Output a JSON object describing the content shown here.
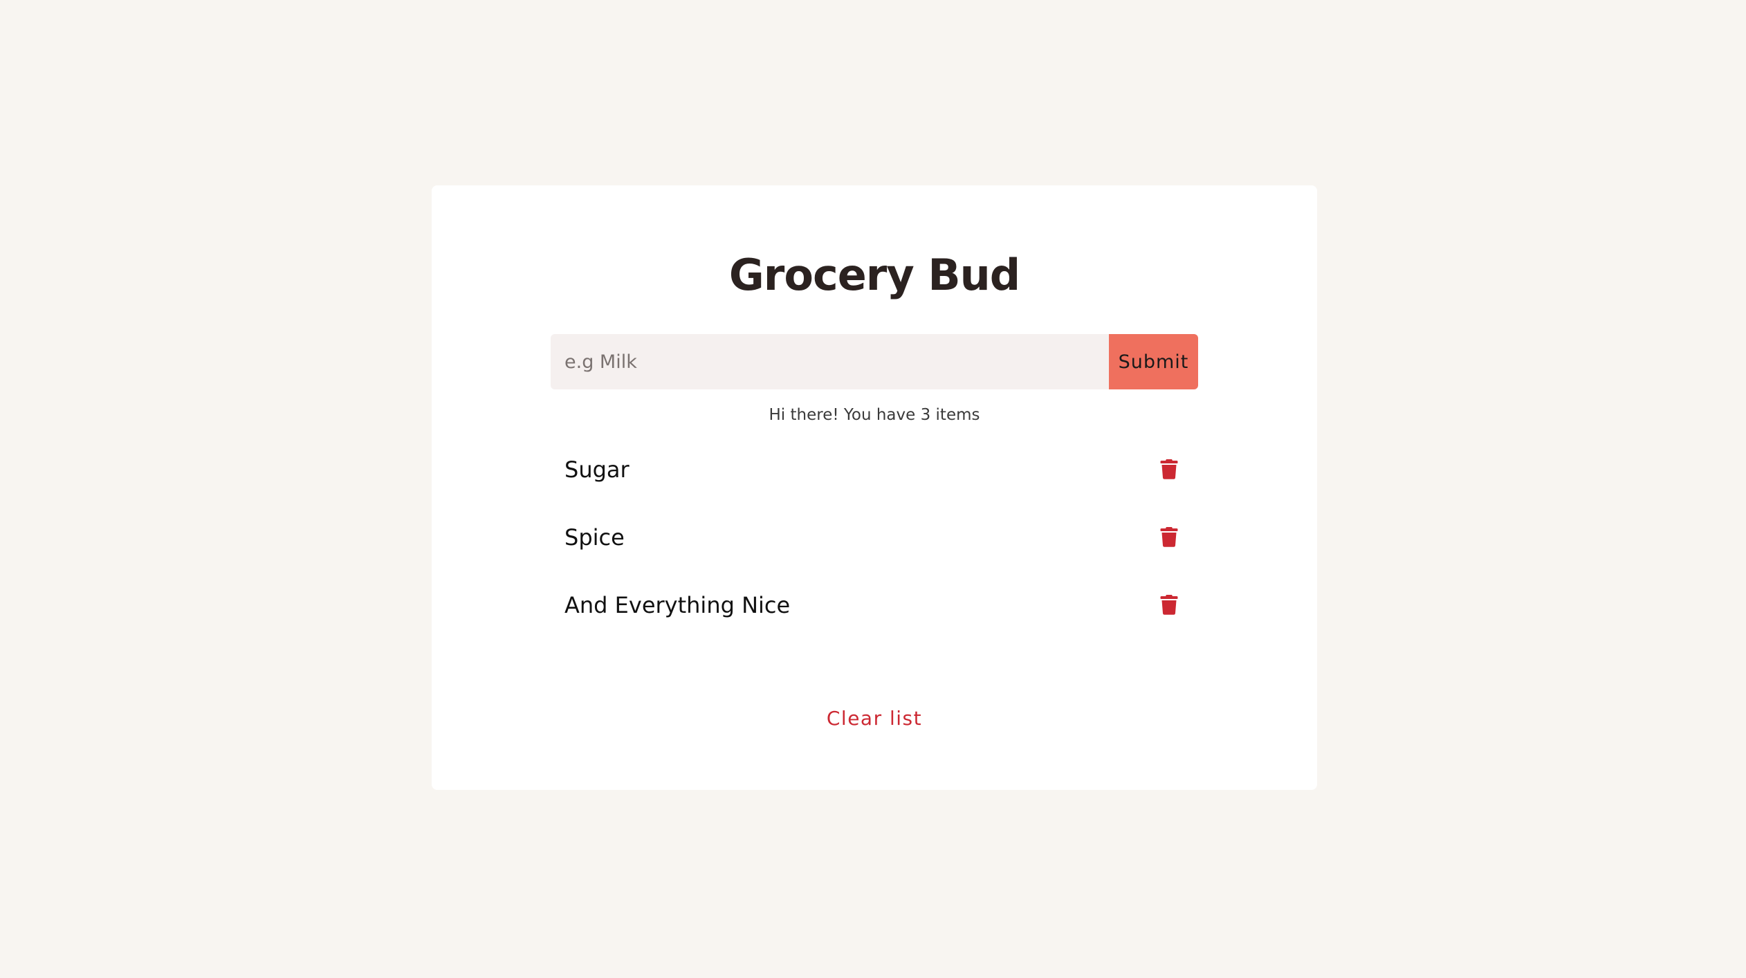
{
  "app": {
    "title": "Grocery Bud"
  },
  "form": {
    "placeholder": "e.g Milk",
    "value": "",
    "submit_label": "Submit"
  },
  "status": {
    "message": "Hi there! You have 3 items"
  },
  "items": [
    {
      "name": "Sugar",
      "delete_icon": "trash-icon"
    },
    {
      "name": "Spice",
      "delete_icon": "trash-icon"
    },
    {
      "name": "And Everything Nice",
      "delete_icon": "trash-icon"
    }
  ],
  "footer": {
    "clear_label": "Clear list"
  },
  "colors": {
    "background": "#f8f5f1",
    "card": "#ffffff",
    "accent": "#ef705e",
    "danger": "#cc2832",
    "input_bg": "#f5f0ef",
    "title_text": "#2b2220"
  }
}
